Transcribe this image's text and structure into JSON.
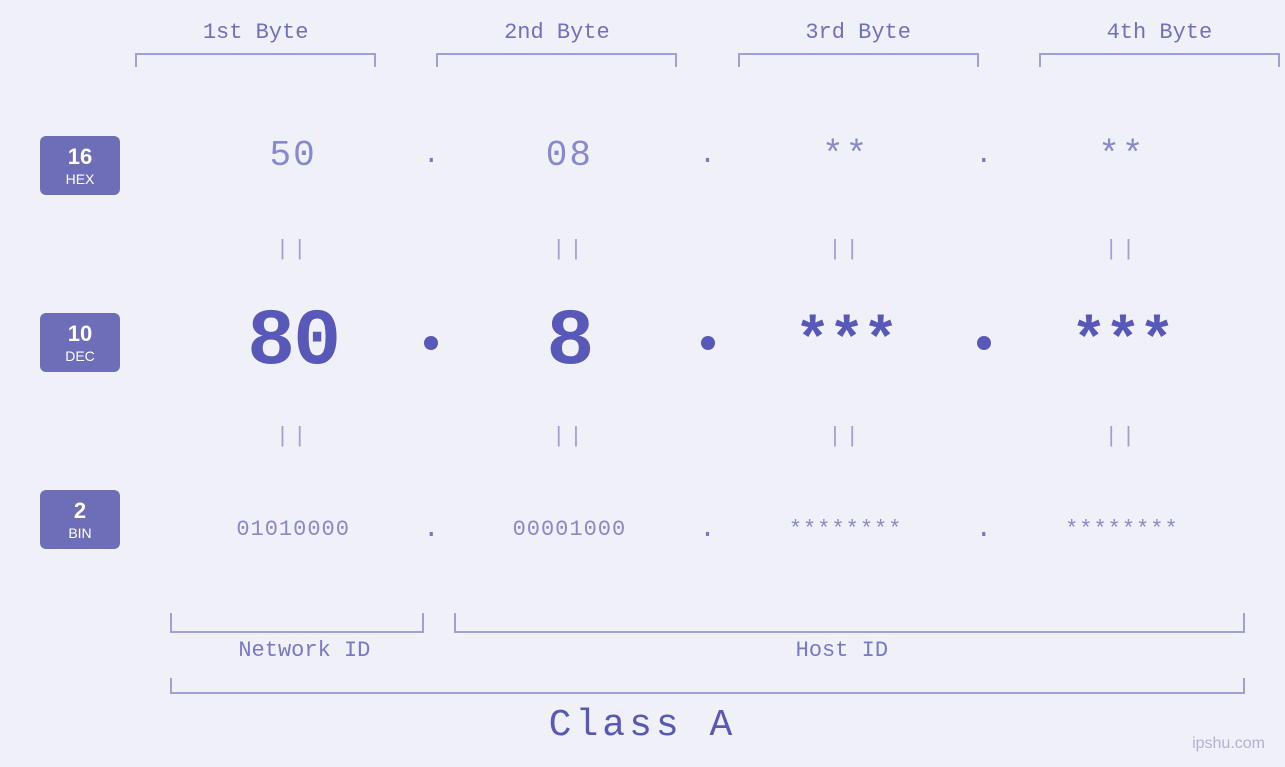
{
  "header": {
    "bytes": [
      {
        "label": "1st Byte"
      },
      {
        "label": "2nd Byte"
      },
      {
        "label": "3rd Byte"
      },
      {
        "label": "4th Byte"
      }
    ]
  },
  "bases": [
    {
      "number": "16",
      "label": "HEX"
    },
    {
      "number": "10",
      "label": "DEC"
    },
    {
      "number": "2",
      "label": "BIN"
    }
  ],
  "rows": {
    "hex": {
      "values": [
        "50",
        "08",
        "**",
        "**"
      ],
      "dots": [
        ".",
        ".",
        ".",
        ""
      ]
    },
    "dec": {
      "values": [
        "80",
        "8",
        "***",
        "***"
      ],
      "dots": [
        "",
        "",
        "",
        ""
      ]
    },
    "bin": {
      "values": [
        "01010000",
        "00001000",
        "********",
        "********"
      ],
      "dots": [
        ".",
        ".",
        ".",
        ""
      ]
    }
  },
  "labels": {
    "network_id": "Network ID",
    "host_id": "Host ID",
    "class": "Class A"
  },
  "watermark": "ipshu.com"
}
